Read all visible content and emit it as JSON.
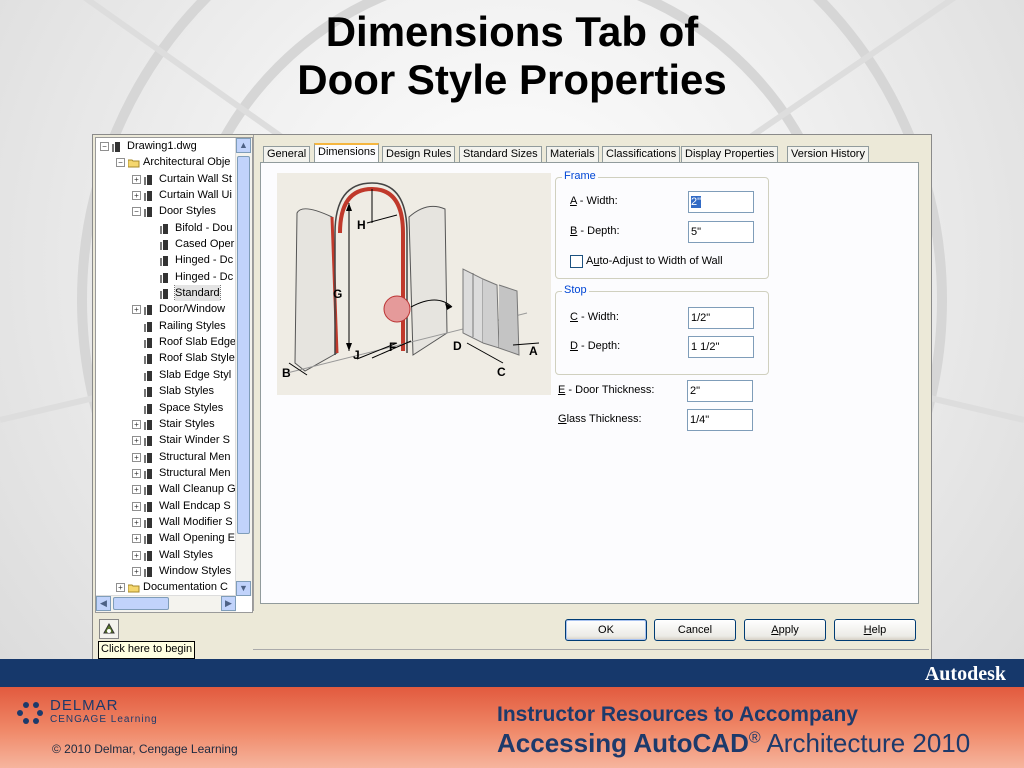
{
  "slide": {
    "title_line1": "Dimensions Tab of",
    "title_line2": "Door Style Properties"
  },
  "tree": {
    "items": [
      {
        "label": "Drawing1.dwg",
        "toggle": "−",
        "icon": "drawing-icon"
      },
      {
        "label": "Architectural Obje",
        "toggle": "−",
        "icon": "folder-icon"
      },
      {
        "label": "Curtain Wall St",
        "toggle": "+",
        "icon": "curtain-wall-icon"
      },
      {
        "label": "Curtain Wall Ui",
        "toggle": "+",
        "icon": "curtain-wall-unit-icon"
      },
      {
        "label": "Door Styles",
        "toggle": "−",
        "icon": "door-icon"
      },
      {
        "label": "Bifold - Dou",
        "toggle": "",
        "icon": "door-icon"
      },
      {
        "label": "Cased Oper",
        "toggle": "",
        "icon": "door-icon"
      },
      {
        "label": "Hinged - Dc",
        "toggle": "",
        "icon": "door-icon"
      },
      {
        "label": "Hinged - Dc",
        "toggle": "",
        "icon": "door-icon"
      },
      {
        "label": "Standard",
        "toggle": "",
        "icon": "door-icon",
        "selected": true
      },
      {
        "label": "Door/Window",
        "toggle": "+",
        "icon": "door-window-icon"
      },
      {
        "label": "Railing Styles",
        "toggle": "",
        "icon": "railing-icon"
      },
      {
        "label": "Roof Slab Edge",
        "toggle": "",
        "icon": "roof-slab-edge-icon"
      },
      {
        "label": "Roof Slab Style",
        "toggle": "",
        "icon": "roof-slab-icon"
      },
      {
        "label": "Slab Edge Styl",
        "toggle": "",
        "icon": "slab-edge-icon"
      },
      {
        "label": "Slab Styles",
        "toggle": "",
        "icon": "slab-icon"
      },
      {
        "label": "Space Styles",
        "toggle": "",
        "icon": "space-icon"
      },
      {
        "label": "Stair Styles",
        "toggle": "+",
        "icon": "stair-icon"
      },
      {
        "label": "Stair Winder S",
        "toggle": "+",
        "icon": "stair-winder-icon"
      },
      {
        "label": "Structural Men",
        "toggle": "+",
        "icon": "structural-member-icon"
      },
      {
        "label": "Structural Men",
        "toggle": "+",
        "icon": "structural-member-icon"
      },
      {
        "label": "Wall Cleanup G",
        "toggle": "+",
        "icon": "wall-cleanup-icon"
      },
      {
        "label": "Wall Endcap S",
        "toggle": "+",
        "icon": "wall-endcap-icon"
      },
      {
        "label": "Wall Modifier S",
        "toggle": "+",
        "icon": "wall-modifier-icon"
      },
      {
        "label": "Wall Opening E",
        "toggle": "+",
        "icon": "wall-opening-icon"
      },
      {
        "label": "Wall Styles",
        "toggle": "+",
        "icon": "wall-icon"
      },
      {
        "label": "Window Styles",
        "toggle": "+",
        "icon": "window-icon"
      },
      {
        "label": "Documentation C",
        "toggle": "+",
        "icon": "folder-icon"
      }
    ]
  },
  "tabs": [
    "General",
    "Dimensions",
    "Design Rules",
    "Standard Sizes",
    "Materials",
    "Classifications",
    "Display Properties",
    "Version History"
  ],
  "active_tab": "Dimensions",
  "diagram_labels": [
    "H",
    "G",
    "J",
    "F",
    "B",
    "D",
    "C",
    "A"
  ],
  "frame": {
    "group_label": "Frame",
    "width_prefix": "A",
    "width_rest": " - Width:",
    "width_value": "2\"",
    "depth_prefix": "B",
    "depth_rest": " - Depth:",
    "depth_value": "5\"",
    "auto_pre": "A",
    "auto_u": "u",
    "auto_rest": "to-Adjust to Width of Wall"
  },
  "stop": {
    "group_label": "Stop",
    "width_prefix": "C",
    "width_rest": " - Width:",
    "width_value": "1/2\"",
    "depth_prefix": "D",
    "depth_rest": " - Depth:",
    "depth_value": "1 1/2\""
  },
  "door_thickness": {
    "prefix": "E",
    "rest": " - Door Thickness:",
    "value": "2\""
  },
  "glass_thickness": {
    "prefix": "G",
    "rest": "lass Thickness:",
    "value": "1/4\""
  },
  "buttons": {
    "ok": "OK",
    "cancel": "Cancel",
    "apply_prefix": "A",
    "apply_rest": "pply",
    "help_prefix": "H",
    "help_rest": "elp"
  },
  "tooltip": "Click here to begin",
  "footer": {
    "brand": "Autodesk",
    "publisher_line1": "DELMAR",
    "publisher_line2": "CENGAGE Learning",
    "copyright": "© 2010  Delmar, Cengage Learning",
    "resource_line1": "Instructor Resources to Accompany",
    "resource_line2_bold": "Accessing AutoCAD",
    "resource_line2_reg": "®",
    "resource_line2_rest": " Architecture 2010"
  }
}
